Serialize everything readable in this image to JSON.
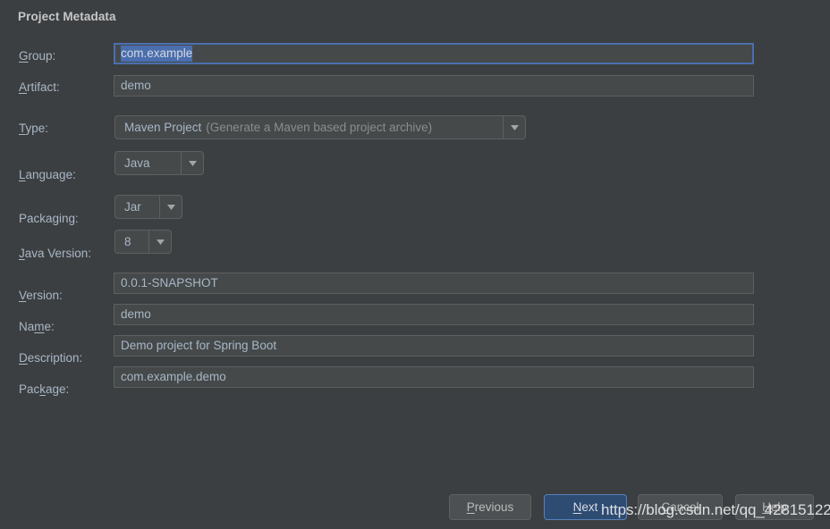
{
  "dialog": {
    "section_title": "Project Metadata",
    "background_color": "#3c3f41",
    "accent_color": "#4b6eaf",
    "text_color": "#a9b7c6"
  },
  "fields": {
    "group": {
      "label_pre": "",
      "label_mn": "G",
      "label_post": "roup:",
      "value": "com.example",
      "selected": true,
      "focused": true
    },
    "artifact": {
      "label_pre": "",
      "label_mn": "A",
      "label_post": "rtifact:",
      "value": "demo",
      "focused": false
    },
    "type": {
      "label_pre": "",
      "label_mn": "T",
      "label_post": "ype:",
      "value": "Maven Project",
      "value_hint": "(Generate a Maven based project archive)"
    },
    "language": {
      "label_pre": "",
      "label_mn": "L",
      "label_post": "anguage:",
      "value": "Java"
    },
    "packaging": {
      "label_pre": "Packa",
      "label_mn": "g",
      "label_post": "ing:",
      "value": "Jar"
    },
    "java_version": {
      "label_pre": "",
      "label_mn": "J",
      "label_post": "ava Version:",
      "value": "8"
    },
    "version": {
      "label_pre": "",
      "label_mn": "V",
      "label_post": "ersion:",
      "value": "0.0.1-SNAPSHOT"
    },
    "name": {
      "label_pre": "Na",
      "label_mn": "m",
      "label_post": "e:",
      "value": "demo"
    },
    "description": {
      "label_pre": "",
      "label_mn": "D",
      "label_post": "escription:",
      "value": "Demo project for Spring Boot"
    },
    "package": {
      "label_pre": "Pac",
      "label_mn": "k",
      "label_post": "age:",
      "value": "com.example.demo"
    }
  },
  "buttons": {
    "previous": {
      "pre": "",
      "mn": "P",
      "post": "revious"
    },
    "next": {
      "pre": "",
      "mn": "N",
      "post": "ext",
      "is_default": true
    },
    "cancel": {
      "pre": "",
      "mn": "C",
      "post": "ancel"
    },
    "help": {
      "pre": "",
      "mn": "H",
      "post": "elp"
    }
  },
  "watermark": {
    "text": "https://blog.csdn.net/qq_42815122"
  }
}
